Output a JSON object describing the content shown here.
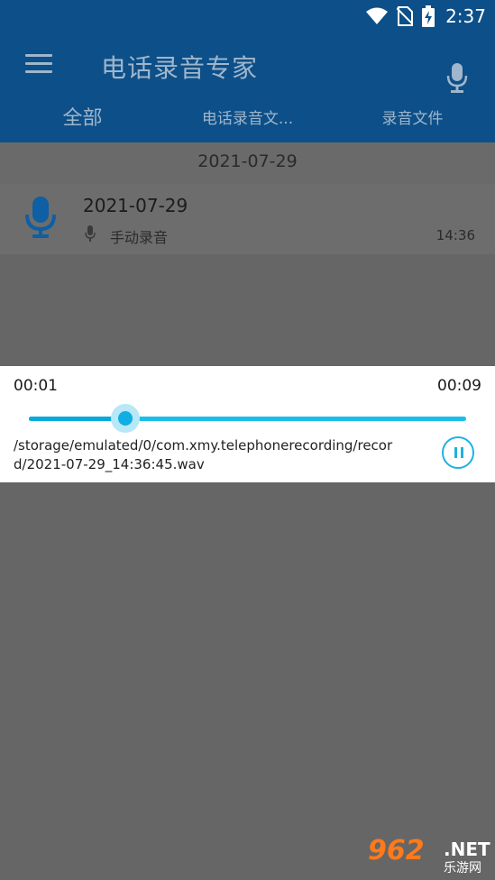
{
  "status_bar": {
    "time": "2:37",
    "icons": [
      "wifi-icon",
      "no-sim-icon",
      "battery-charging-icon"
    ]
  },
  "app_bar": {
    "menu_icon": "hamburger-menu-icon",
    "title": "电话录音专家",
    "action_icon": "microphone-icon",
    "tabs": [
      {
        "label": "全部",
        "active": true
      },
      {
        "label": "电话录音文...",
        "active": false
      },
      {
        "label": "录音文件",
        "active": false
      }
    ]
  },
  "list": {
    "date_header": "2021-07-29",
    "records": [
      {
        "icon": "microphone-icon",
        "title": "2021-07-29",
        "type_icon": "small-microphone-icon",
        "type": "手动录音",
        "time": "14:36"
      }
    ]
  },
  "player": {
    "current_time": "00:01",
    "duration": "00:09",
    "progress_fraction": 0.22,
    "file_path": "/storage/emulated/0/com.xmy.telephonerecording/record/2021-07-29_14:36:45.wav",
    "pause_icon": "pause-icon"
  },
  "colors": {
    "app_bar": "#0d4f88",
    "accent": "#1bbde9",
    "overlay": "#666666"
  },
  "watermark": {
    "logo": "962",
    "net": ".NET",
    "site": "乐游网"
  }
}
